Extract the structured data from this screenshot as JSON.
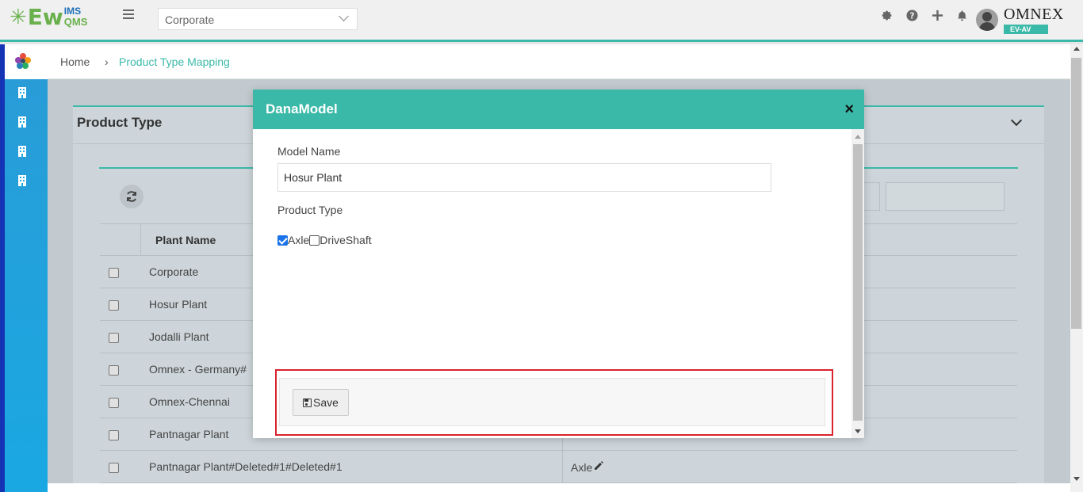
{
  "header": {
    "logo": {
      "ew": "Ew",
      "ims": "IMS",
      "qms": "QMS"
    },
    "plant_select": {
      "value": "Corporate"
    },
    "brand": {
      "name": "OMNEX",
      "sub": "EV-AV"
    },
    "icons": [
      "gear-icon",
      "help-icon",
      "plus-icon",
      "bell-icon",
      "user-avatar"
    ]
  },
  "breadcrumb": {
    "home": "Home",
    "separator": "›",
    "current": "Product Type Mapping"
  },
  "panel": {
    "title": "Product Type"
  },
  "grid": {
    "columns": [
      "Plant Name"
    ],
    "rows": [
      {
        "plant": "Corporate",
        "product_type": ""
      },
      {
        "plant": "Hosur Plant",
        "product_type": ""
      },
      {
        "plant": "Jodalli Plant",
        "product_type": ""
      },
      {
        "plant": "Omnex - Germany#",
        "product_type": ""
      },
      {
        "plant": "Omnex-Chennai",
        "product_type": ""
      },
      {
        "plant": "Pantnagar Plant",
        "product_type": ""
      },
      {
        "plant": "Pantnagar Plant#Deleted#1#Deleted#1",
        "product_type": "Axle"
      }
    ]
  },
  "modal": {
    "title": "DanaModel",
    "close": "×",
    "model_name_label": "Model Name",
    "model_name_value": "Hosur Plant",
    "product_type_label": "Product Type",
    "options": [
      {
        "label": "Axle",
        "checked": true
      },
      {
        "label": "DriveShaft",
        "checked": false
      }
    ],
    "save_label": "Save"
  },
  "colors": {
    "accent": "#3bb9a8",
    "highlight": "#d9232d",
    "sidebar": "#1aa8e2",
    "checkbox_checked": "#1a73e8"
  }
}
